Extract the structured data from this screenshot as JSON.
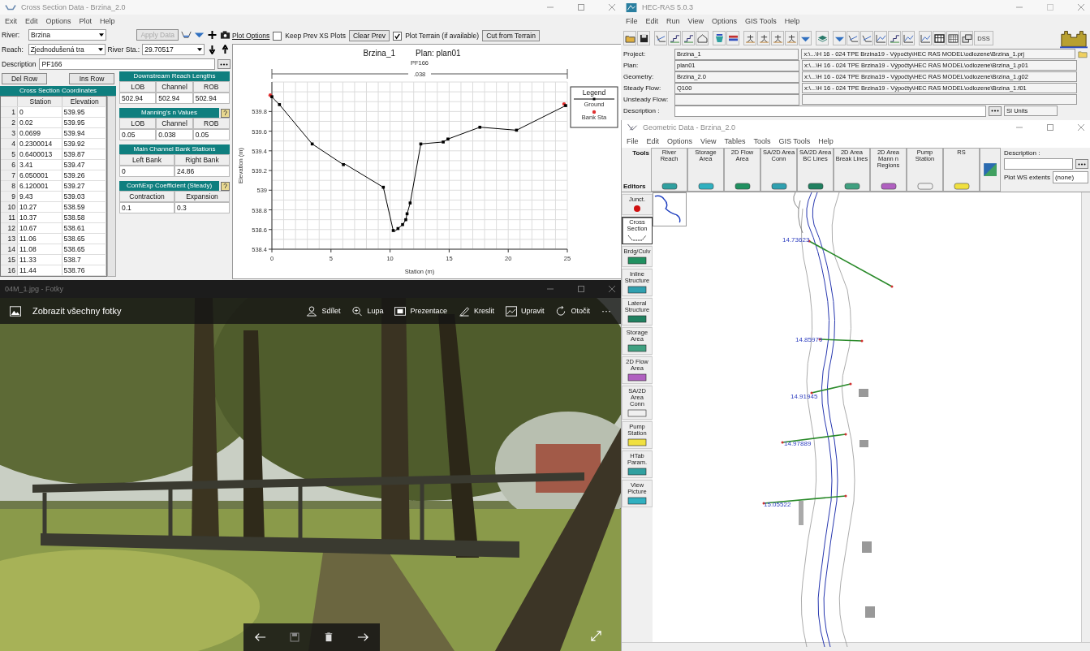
{
  "cross_section_window": {
    "title": "Cross Section Data - Brzina_2.0",
    "menu": [
      "Exit",
      "Edit",
      "Options",
      "Plot",
      "Help"
    ],
    "river_label": "River:",
    "river": "Brzina",
    "apply_button": {
      "label": "Apply Data",
      "disabled": true
    },
    "reach_label": "Reach:",
    "reach": "Zjednodušená tra",
    "river_sta_label": "River Sta.:",
    "river_sta": "29.70517",
    "description_label": "Description",
    "description": "PF166",
    "del_row": "Del Row",
    "ins_row": "Ins Row",
    "coordinates": {
      "title": "Cross Section Coordinates",
      "columns": [
        "Station",
        "Elevation"
      ],
      "rows": [
        {
          "index": "1",
          "station": "0",
          "elevation": "539.95"
        },
        {
          "index": "2",
          "station": "0.02",
          "elevation": "539.95"
        },
        {
          "index": "3",
          "station": "0.0699",
          "elevation": "539.94"
        },
        {
          "index": "4",
          "station": "0.2300014",
          "elevation": "539.92"
        },
        {
          "index": "5",
          "station": "0.6400013",
          "elevation": "539.87"
        },
        {
          "index": "6",
          "station": "3.41",
          "elevation": "539.47"
        },
        {
          "index": "7",
          "station": "6.050001",
          "elevation": "539.26"
        },
        {
          "index": "8",
          "station": "6.120001",
          "elevation": "539.27"
        },
        {
          "index": "9",
          "station": "9.43",
          "elevation": "539.03"
        },
        {
          "index": "10",
          "station": "10.27",
          "elevation": "538.59"
        },
        {
          "index": "11",
          "station": "10.37",
          "elevation": "538.58"
        },
        {
          "index": "12",
          "station": "10.67",
          "elevation": "538.61"
        },
        {
          "index": "13",
          "station": "11.06",
          "elevation": "538.65"
        },
        {
          "index": "14",
          "station": "11.08",
          "elevation": "538.65"
        },
        {
          "index": "15",
          "station": "11.33",
          "elevation": "538.7"
        },
        {
          "index": "16",
          "station": "11.44",
          "elevation": "538.76"
        }
      ]
    },
    "groups": [
      {
        "title": "Downstream Reach Lengths",
        "help": false,
        "columns": [
          "LOB",
          "Channel",
          "ROB"
        ],
        "values": [
          "502.94",
          "502.94",
          "502.94"
        ]
      },
      {
        "title": "Manning's n Values",
        "help": true,
        "columns": [
          "LOB",
          "Channel",
          "ROB"
        ],
        "values": [
          "0.05",
          "0.038",
          "0.05"
        ]
      },
      {
        "title": "Main Channel Bank Stations",
        "help": false,
        "columns": [
          "Left Bank",
          "Right Bank"
        ],
        "values": [
          "0",
          "24.86"
        ]
      },
      {
        "title": "Cont\\Exp Coefficient (Steady)",
        "help": true,
        "columns": [
          "Contraction",
          "Expansion"
        ],
        "values": [
          "0.1",
          "0.3"
        ]
      }
    ],
    "plot_toolbar": {
      "plot_options": "Plot Options",
      "keep_prev": {
        "label": "Keep Prev XS Plots",
        "checked": false
      },
      "clear_prev": "Clear Prev",
      "plot_terrain": {
        "label": "Plot Terrain (if available)",
        "checked": true
      },
      "cut_from_terrain": "Cut from Terrain"
    },
    "plot": {
      "bank_marker": {
        "label": "Bank Sta",
        "color": "#e03030"
      },
      "plan": "Plan: plan01",
      "subtitle": "PF166",
      "n_label": ".038",
      "legend_title": "Legend",
      "chart_data": {
        "type": "line",
        "title": "Brzina_1",
        "xlabel": "Station (m)",
        "ylabel": "Elevation (m)",
        "x": [
          0,
          0.02,
          0.0699,
          0.2300014,
          0.6400013,
          3.41,
          6.050001,
          6.120001,
          9.43,
          10.27,
          10.37,
          10.67,
          11.06,
          11.08,
          11.33,
          11.44,
          11.7,
          12.6,
          14.5,
          14.9,
          17.6,
          20.7,
          24.86
        ],
        "series": [
          {
            "name": "Ground",
            "color": "#000000",
            "marker": "square",
            "values": [
              539.95,
              539.95,
              539.94,
              539.92,
              539.87,
              539.47,
              539.26,
              539.27,
              539.03,
              538.59,
              538.58,
              538.61,
              538.65,
              538.65,
              538.7,
              538.76,
              538.87,
              539.47,
              539.49,
              539.52,
              539.64,
              539.61,
              539.86
            ]
          }
        ],
        "grid": true,
        "xlim": [
          0,
          25
        ],
        "ylim": [
          538.4,
          540.1
        ],
        "xticks": [
          0,
          5,
          10,
          15,
          20,
          25
        ],
        "yticks": [
          538.4,
          538.6,
          538.8,
          539.0,
          539.2,
          539.4,
          539.6,
          539.8
        ]
      }
    }
  },
  "photo_window": {
    "title": "04M_1.jpg - Fotky",
    "see_all": "Zobrazit všechny fotky",
    "actions": [
      "Sdílet",
      "Lupa",
      "Prezentace",
      "Kreslit",
      "Upravit",
      "Otočit"
    ],
    "more": "···",
    "photo": {
      "kind": "picture"
    }
  },
  "hec_ras_window": {
    "title": "HEC-RAS 5.0.3",
    "menu": [
      "File",
      "Edit",
      "Run",
      "View",
      "Options",
      "GIS Tools",
      "Help"
    ],
    "dss_button": "DSS",
    "fields": [
      {
        "label": "Project:",
        "value": "Brzina_1",
        "path": "x:\\...\\H 16 - 024 TPE Brzina19 - Výpočty\\HEC RAS MODEL\\odlozene\\Brzina_1.prj"
      },
      {
        "label": "Plan:",
        "value": "plan01",
        "path": "x:\\...\\H 16 - 024 TPE Brzina19 - Výpočty\\HEC RAS MODEL\\odlozene\\Brzina_1.p01"
      },
      {
        "label": "Geometry:",
        "value": "Brzina_2.0",
        "path": "x:\\...\\H 16 - 024 TPE Brzina19 - Výpočty\\HEC RAS MODEL\\odlozene\\Brzina_1.g02"
      },
      {
        "label": "Steady Flow:",
        "value": "Q100",
        "path": "x:\\...\\H 16 - 024 TPE Brzina19 - Výpočty\\HEC RAS MODEL\\odlozene\\Brzina_1.f01"
      },
      {
        "label": "Unsteady Flow:"
      }
    ],
    "description_label": "Description :",
    "units": "SI Units"
  },
  "geometric_window": {
    "title": "Geometric Data - Brzina_2.0",
    "menu": [
      "File",
      "Edit",
      "Options",
      "View",
      "Tables",
      "Tools",
      "GIS Tools",
      "Help"
    ],
    "tools_label": "Tools",
    "editors_label": "Editors",
    "tool_buttons": [
      "River Reach",
      "Storage Area",
      "2D Flow Area",
      "SA/2D Area Conn",
      "SA/2D Area BC Lines",
      "2D Area Break Lines",
      "2D Area Mann n Regions",
      "Pump Station",
      "RS"
    ],
    "description_label": "Description :",
    "plot_ws_label": "Plot WS extents",
    "plot_ws_value": "(none)",
    "editors": [
      {
        "label": "Junct.",
        "selected": false
      },
      {
        "label": "Cross Section",
        "selected": true
      },
      {
        "label": "Brdg/Culv",
        "selected": false
      },
      {
        "label": "Inline Structure",
        "selected": false
      },
      {
        "label": "Lateral Structure",
        "selected": false
      },
      {
        "label": "Storage Area",
        "selected": false
      },
      {
        "label": "2D Flow Area",
        "selected": false
      },
      {
        "label": "SA/2D Area Conn",
        "selected": false
      },
      {
        "label": "Pump Station",
        "selected": false
      },
      {
        "label": "HTab Param.",
        "selected": false
      },
      {
        "label": "View Picture",
        "selected": false
      }
    ],
    "cross_sections": [
      "14.73623",
      "14.85979",
      "14.91945",
      "14.97889",
      "15.05522"
    ]
  }
}
